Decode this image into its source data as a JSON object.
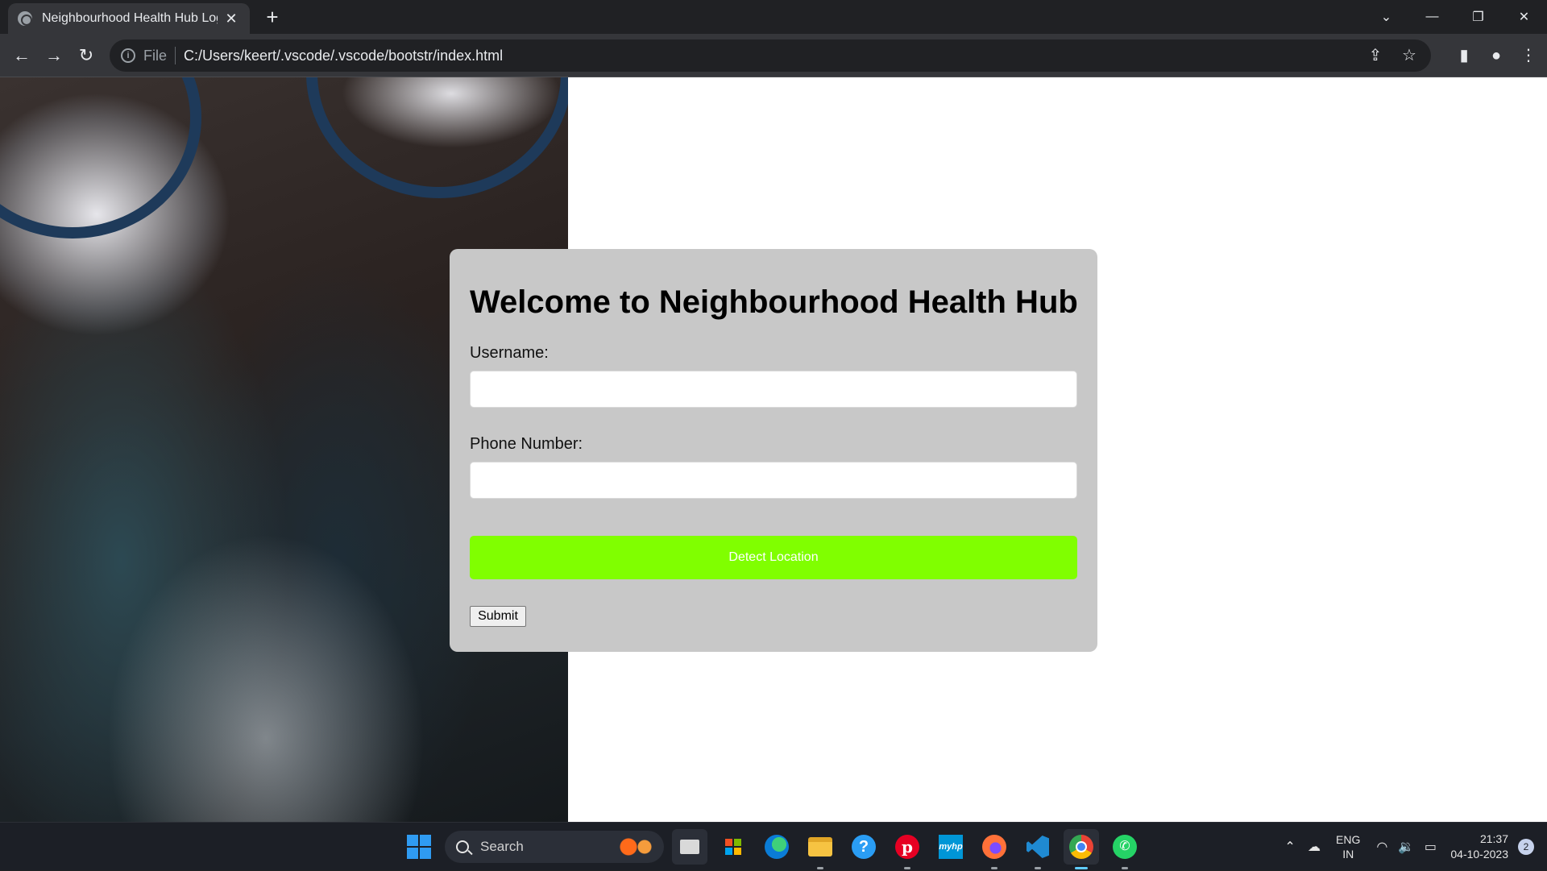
{
  "browser": {
    "tab_title": "Neighbourhood Health Hub Login",
    "new_tab_symbol": "+",
    "url_scheme_label": "File",
    "url": "C:/Users/keert/.vscode/.vscode/bootstr/index.html"
  },
  "page": {
    "title": "Welcome to Neighbourhood Health Hub",
    "username_label": "Username:",
    "username_value": "",
    "phone_label": "Phone Number:",
    "phone_value": "",
    "detect_location_label": "Detect Location",
    "submit_label": "Submit",
    "colors": {
      "card_bg": "#c8c8c8",
      "detect_button_bg": "#80ff00",
      "detect_button_text": "#ffffff"
    }
  },
  "taskbar": {
    "search_label": "Search",
    "apps": [
      "task-view-icon",
      "microsoft-store-icon",
      "edge-icon",
      "file-explorer-icon",
      "help-icon",
      "pinterest-icon",
      "myhp-icon",
      "firefox-icon",
      "vscode-icon",
      "chrome-icon",
      "whatsapp-icon"
    ],
    "language_top": "ENG",
    "language_bottom": "IN",
    "time": "21:37",
    "date": "04-10-2023",
    "notification_count": "2"
  }
}
